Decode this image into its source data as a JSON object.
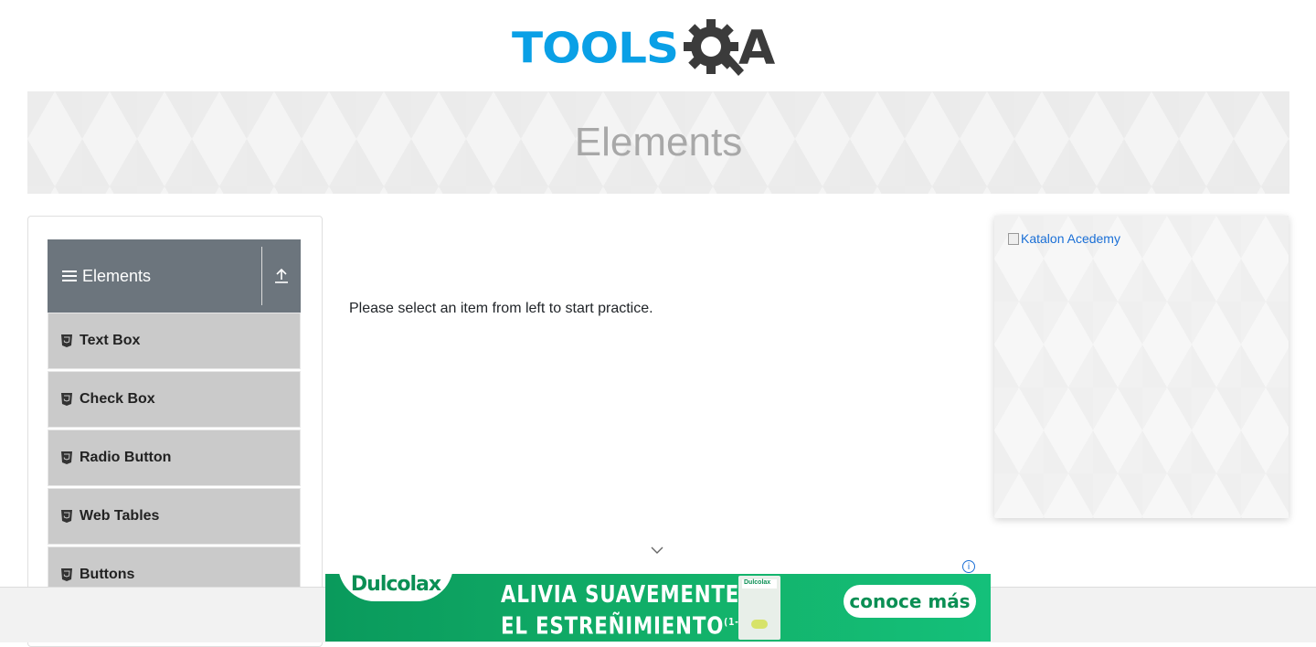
{
  "header": {
    "logo_tools": "TOOLS",
    "logo_a": "A"
  },
  "banner": {
    "title": "Elements"
  },
  "sidebar": {
    "group_title": "Elements",
    "items": [
      {
        "label": "Text Box"
      },
      {
        "label": "Check Box"
      },
      {
        "label": "Radio Button"
      },
      {
        "label": "Web Tables"
      },
      {
        "label": "Buttons"
      }
    ]
  },
  "main": {
    "message": "Please select an item from left to start practice."
  },
  "right_ad": {
    "image_alt": "Katalon Acedemy"
  },
  "bottom_ad": {
    "brand": "Dulcolax",
    "headline_line1": "ALIVIA SUAVEMENTE",
    "headline_line2": "EL ESTREÑIMIENTO",
    "footnote": "(1-3)",
    "package_label": "Dulcolax",
    "cta": "conoce más",
    "info_symbol": "i"
  },
  "colors": {
    "logo_blue": "#0aa0e6",
    "logo_dark": "#3b3b3b",
    "group_header_bg": "#6c757d",
    "menu_item_bg": "#cacaca",
    "ad_green": "#13b36b"
  },
  "icons": {
    "group": "hamburger-icon",
    "collapse": "upload-icon",
    "menu_item": "html5-icon",
    "scroll": "chevron-down-icon",
    "ad_info": "info-icon"
  }
}
